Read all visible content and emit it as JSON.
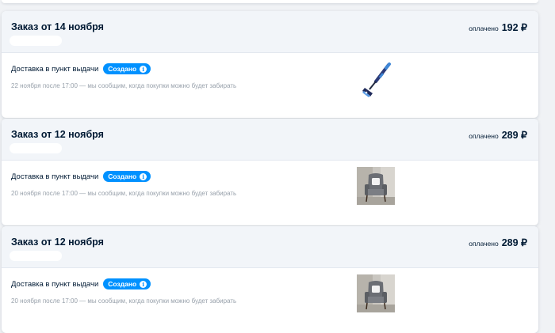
{
  "orders": [
    {
      "title": "Заказ от 14 ноября",
      "paid_label": "оплачено",
      "paid_amount": "192 ₽",
      "delivery_label": "Доставка в пункт выдачи",
      "status_label": "Создано",
      "pickup_note": "22 ноября после 17:00 — мы сообщим, когда покупки можно будет забирать",
      "product_icon": "ice-scraper"
    },
    {
      "title": "Заказ от 12 ноября",
      "paid_label": "оплачено",
      "paid_amount": "289 ₽",
      "delivery_label": "Доставка в пункт выдачи",
      "status_label": "Создано",
      "pickup_note": "20 ноября после 17:00 — мы сообщим, когда покупки можно будет забирать",
      "product_icon": "armchair"
    },
    {
      "title": "Заказ от 12 ноября",
      "paid_label": "оплачено",
      "paid_amount": "289 ₽",
      "delivery_label": "Доставка в пункт выдачи",
      "status_label": "Создано",
      "pickup_note": "20 ноября после 17:00 — мы сообщим, когда покупки можно будет забирать",
      "product_icon": "armchair"
    }
  ],
  "colors": {
    "accent": "#0091ff",
    "text": "#001a34",
    "muted": "#98a1ab",
    "header_bg": "#f2f5f9"
  }
}
